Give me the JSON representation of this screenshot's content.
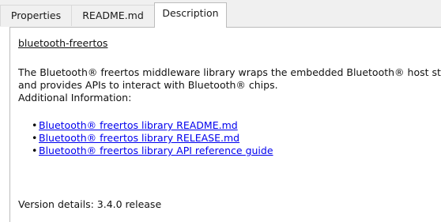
{
  "tabs": [
    {
      "label": "Properties",
      "active": false
    },
    {
      "label": "README.md",
      "active": false
    },
    {
      "label": "Description",
      "active": true
    }
  ],
  "description": {
    "title": "bluetooth-freertos",
    "paragraph_lines": [
      "The Bluetooth® freertos middleware library wraps the embedded Bluetooth® host stack",
      "and provides APIs to interact with Bluetooth® chips.",
      "Additional Information:"
    ],
    "links": [
      "Bluetooth® freertos library README.md",
      "Bluetooth® freertos library RELEASE.md",
      "Bluetooth® freertos library API reference guide"
    ],
    "version": "Version details: 3.4.0 release"
  },
  "colors": {
    "link": "#0000ee",
    "tab_bar_bg": "#f0f0f0",
    "panel_border": "#bcbcbc"
  }
}
